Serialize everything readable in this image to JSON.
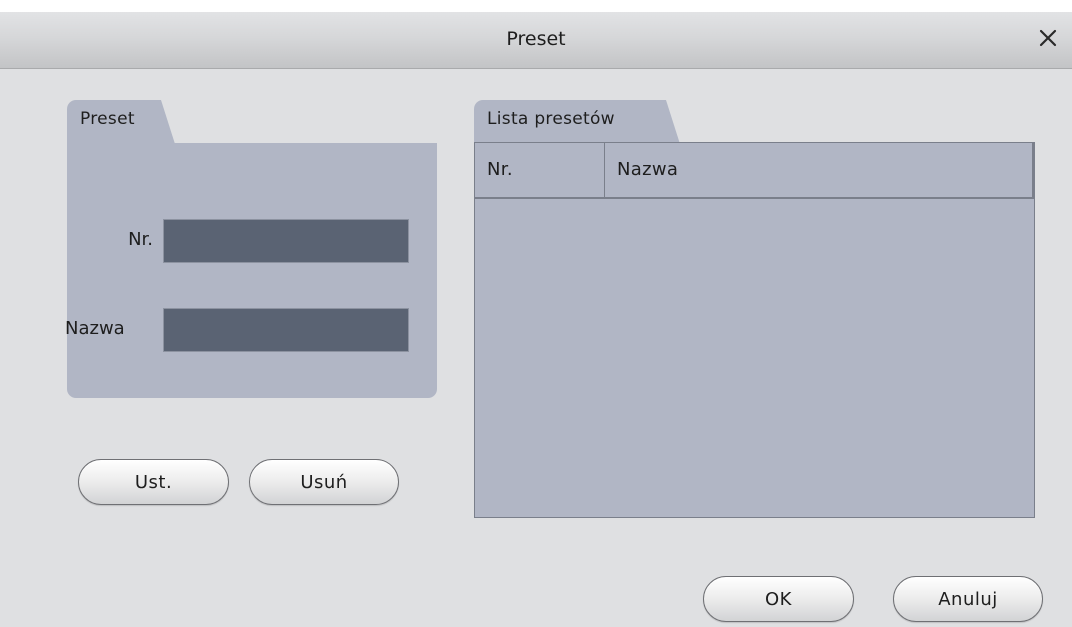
{
  "window": {
    "title": "Preset",
    "close_icon": "close-icon"
  },
  "preset_panel": {
    "tab_label": "Preset",
    "nr_label": "Nr.",
    "nr_value": "",
    "name_label": "Nazwa",
    "name_value": ""
  },
  "list_panel": {
    "tab_label": "Lista presetów",
    "columns": [
      "Nr.",
      "Nazwa"
    ],
    "rows": []
  },
  "buttons": {
    "set_label": "Ust.",
    "delete_label": "Usuń",
    "ok_label": "OK",
    "cancel_label": "Anuluj"
  },
  "colors": {
    "panel": "#b1b6c5",
    "input": "#5a6373",
    "dialog_bg": "#dfe0e2"
  }
}
